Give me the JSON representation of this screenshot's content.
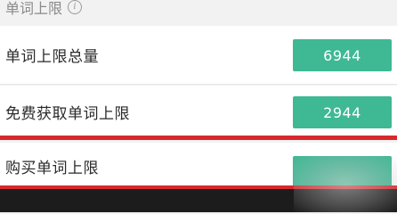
{
  "section": {
    "title": "单词上限",
    "info_icon": "info-circle-icon",
    "info_glyph": "i"
  },
  "rows": [
    {
      "label": "单词上限总量",
      "value": "6944"
    },
    {
      "label": "免费获取单词上限",
      "value": "2944"
    },
    {
      "label": "购买单词上限",
      "value": ""
    }
  ],
  "colors": {
    "accent_green": "#3fb894",
    "highlight_red": "#d7282b",
    "bottom_bar": "#1c1c1c"
  }
}
